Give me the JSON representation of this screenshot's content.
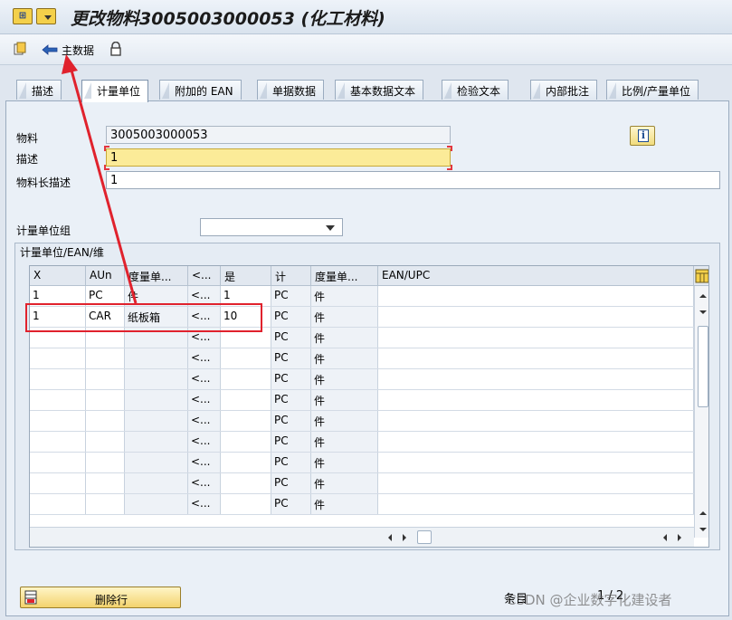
{
  "window": {
    "title": "更改物料3005003000053 (化工材料)"
  },
  "toolbar": {
    "master_data_label": "主数据"
  },
  "tabs": [
    {
      "label": "描述"
    },
    {
      "label": "计量单位"
    },
    {
      "label": "附加的 EAN"
    },
    {
      "label": "单据数据"
    },
    {
      "label": "基本数据文本"
    },
    {
      "label": "检验文本"
    },
    {
      "label": "内部批注"
    },
    {
      "label": "比例/产量单位"
    }
  ],
  "form": {
    "material_label": "物料",
    "material_value": "3005003000053",
    "desc_label": "描述",
    "desc_value": "1",
    "long_desc_label": "物料长描述",
    "long_desc_value": "1",
    "uom_group_label": "计量单位组",
    "uom_group_value": ""
  },
  "group": {
    "title": "计量单位/EAN/维"
  },
  "table": {
    "headers": [
      "X",
      "AUn",
      "度量单...",
      "<...",
      "是",
      "计",
      "度量单...",
      "EAN/UPC"
    ],
    "rows": [
      [
        "1",
        "PC",
        "件",
        "<...",
        "1",
        "PC",
        "件",
        ""
      ],
      [
        "1",
        "CAR",
        "纸板箱",
        "<...",
        "10",
        "PC",
        "件",
        ""
      ],
      [
        "",
        "",
        "",
        "<...",
        "",
        "PC",
        "件",
        ""
      ],
      [
        "",
        "",
        "",
        "<...",
        "",
        "PC",
        "件",
        ""
      ],
      [
        "",
        "",
        "",
        "<...",
        "",
        "PC",
        "件",
        ""
      ],
      [
        "",
        "",
        "",
        "<...",
        "",
        "PC",
        "件",
        ""
      ],
      [
        "",
        "",
        "",
        "<...",
        "",
        "PC",
        "件",
        ""
      ],
      [
        "",
        "",
        "",
        "<...",
        "",
        "PC",
        "件",
        ""
      ],
      [
        "",
        "",
        "",
        "<...",
        "",
        "PC",
        "件",
        ""
      ],
      [
        "",
        "",
        "",
        "<...",
        "",
        "PC",
        "件",
        ""
      ],
      [
        "",
        "",
        "",
        "<...",
        "",
        "PC",
        "件",
        ""
      ]
    ]
  },
  "footer": {
    "delete_row_label": "删除行",
    "entry_label": "条目",
    "entry_count": "1 / 2"
  },
  "watermark": "CSDN @企业数字化建设者",
  "colors": {
    "annotation_red": "#e0222d",
    "focus_field": "#fbeb98",
    "background": "#dfe6ef"
  }
}
